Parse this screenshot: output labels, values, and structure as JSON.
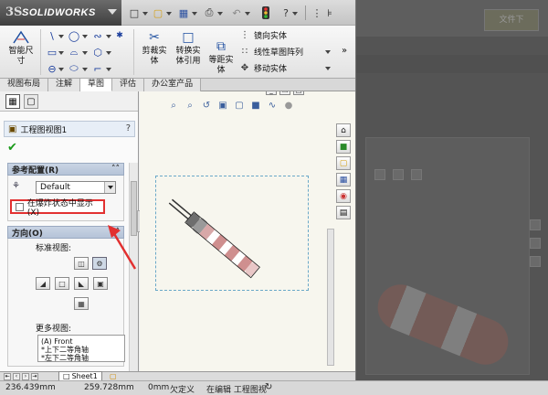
{
  "app": {
    "logo_mark": "3S",
    "logo_text": "SOLIDWORKS"
  },
  "quick_toolbar": {
    "icons": [
      "new-doc-icon",
      "open-folder-icon",
      "save-icon",
      "print-icon",
      "undo-icon",
      "traffic-light-icon",
      "help-icon"
    ]
  },
  "command_manager": {
    "smart_dimension": "智能尺\n寸",
    "trim_entities": "剪裁实\n体",
    "convert_entities": "转换实\n体引用",
    "offset_entities": "等距实\n体",
    "mirror_entities": "镜向实体",
    "linear_pattern": "线性草图阵列",
    "move_entities": "移动实体"
  },
  "tabs": [
    {
      "label": "视图布局",
      "active": false
    },
    {
      "label": "注解",
      "active": false
    },
    {
      "label": "草图",
      "active": true
    },
    {
      "label": "评估",
      "active": false
    },
    {
      "label": "办公室产品",
      "active": false
    }
  ],
  "property_manager": {
    "title": "工程图视图1",
    "help": "?",
    "reference_config": {
      "header": "参考配置(R)",
      "config_value": "Default",
      "explode_label": "在爆炸状态中显示(X)",
      "explode_checked": false
    },
    "orientation": {
      "header": "方向(O)",
      "standard_views_label": "标准视图:",
      "more_views_label": "更多视图:",
      "more_views_items": [
        "(A) Front",
        "*上下二等角轴",
        "*左下二等角轴"
      ]
    }
  },
  "sheet_tab": "Sheet1",
  "status_bar": {
    "x": "236.439mm",
    "y": "259.728mm",
    "z": "0mm",
    "state": "欠定义",
    "mode": "在编辑 工程图视"
  },
  "background_window": {
    "button_label": "文件下"
  },
  "colors": {
    "accent_blue": "#1f4fa0",
    "annotation_red": "#e23030",
    "check_green": "#1a9a1a"
  }
}
